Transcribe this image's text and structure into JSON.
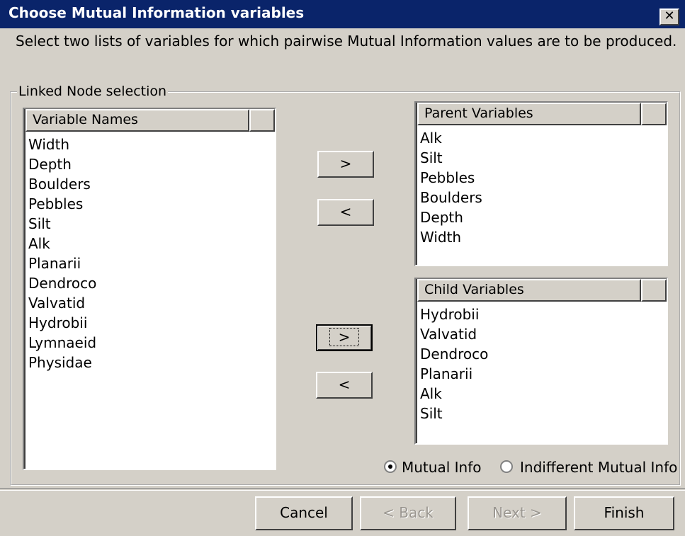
{
  "window": {
    "title": "Choose Mutual Information variables",
    "close_icon": "close-icon",
    "close_glyph": "✕"
  },
  "instruction": "Select two lists of variables for which pairwise Mutual Information values are to be produced.",
  "group": {
    "label": "Linked Node selection"
  },
  "variable_list": {
    "header": "Variable Names",
    "items": [
      "Width",
      "Depth",
      "Boulders",
      "Pebbles",
      "Silt",
      "Alk",
      "Planarii",
      "Dendroco",
      "Valvatid",
      "Hydrobii",
      "Lymnaeid",
      "Physidae"
    ]
  },
  "parent_list": {
    "header": "Parent Variables",
    "items": [
      "Alk",
      "Silt",
      "Pebbles",
      "Boulders",
      "Depth",
      "Width"
    ]
  },
  "child_list": {
    "header": "Child Variables",
    "items": [
      "Hydrobii",
      "Valvatid",
      "Dendroco",
      "Planarii",
      "Alk",
      "Silt"
    ]
  },
  "buttons": {
    "add_parent": ">",
    "remove_parent": "<",
    "add_child": ">",
    "remove_child": "<"
  },
  "radio": {
    "mutual_info": "Mutual Info",
    "indifferent_mutual_info": "Indifferent Mutual Info",
    "selected": "mutual_info"
  },
  "footer": {
    "cancel": "Cancel",
    "back": "< Back",
    "next": "Next >",
    "finish": "Finish"
  }
}
